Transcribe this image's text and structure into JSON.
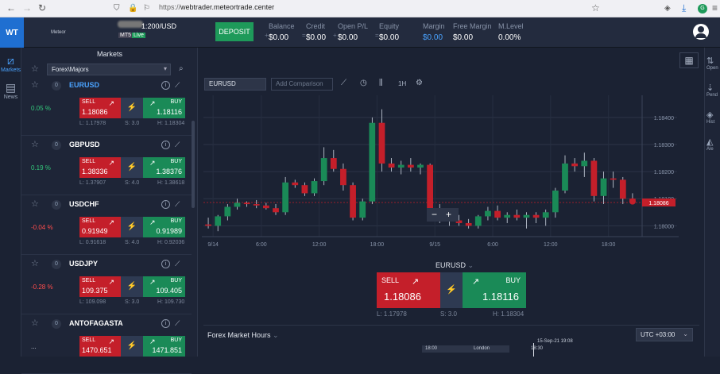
{
  "browser": {
    "url_prefix": "https://",
    "url_host": "webtrader.meteortrade.center"
  },
  "header": {
    "logo": "WT",
    "brand_text": "Meteor",
    "account": "1:200/USD",
    "platform_badge": "MT5",
    "live_badge": "Live",
    "deposit_label": "DEPOSIT",
    "stats": [
      {
        "label": "Balance",
        "value": "$0.00",
        "color": "#ffffff"
      },
      {
        "label": "Credit",
        "value": "$0.00",
        "color": "#ffffff"
      },
      {
        "label": "Open P/L",
        "value": "$0.00",
        "color": "#ffffff"
      },
      {
        "label": "Equity",
        "value": "$0.00",
        "color": "#ffffff"
      },
      {
        "label": "Margin",
        "value": "$0.00",
        "color": "#4aa3ff"
      },
      {
        "label": "Free Margin",
        "value": "$0.00",
        "color": "#ffffff"
      },
      {
        "label": "M.Level",
        "value": "0.00%",
        "color": "#ffffff"
      }
    ]
  },
  "left_rail": {
    "items": [
      {
        "label": "Markets",
        "icon": "chart-icon",
        "active": true
      },
      {
        "label": "News",
        "icon": "news-icon",
        "active": false
      }
    ]
  },
  "markets": {
    "title": "Markets",
    "category": "Forex\\Majors",
    "sell_label": "SELL",
    "buy_label": "BUY",
    "rows": [
      {
        "badge": "0",
        "symbol": "EURUSD",
        "change": "0.05 %",
        "dir": "pos",
        "sell": "1.18086",
        "buy": "1.18116",
        "low": "L: 1.17978",
        "spread": "S: 3.0",
        "high": "H: 1.18304",
        "active": true
      },
      {
        "badge": "0",
        "symbol": "GBPUSD",
        "change": "0.19 %",
        "dir": "pos",
        "sell": "1.38336",
        "buy": "1.38376",
        "low": "L: 1.37907",
        "spread": "S: 4.0",
        "high": "H: 1.38618",
        "active": false
      },
      {
        "badge": "0",
        "symbol": "USDCHF",
        "change": "-0.04 %",
        "dir": "neg",
        "sell": "0.91949",
        "buy": "0.91989",
        "low": "L: 0.91618",
        "spread": "S: 4.0",
        "high": "H: 0.92036",
        "active": false
      },
      {
        "badge": "0",
        "symbol": "USDJPY",
        "change": "-0.28 %",
        "dir": "neg",
        "sell": "109.375",
        "buy": "109.405",
        "low": "L: 109.098",
        "spread": "S: 3.0",
        "high": "H: 109.730",
        "active": false
      },
      {
        "badge": "0",
        "symbol": "ANTOFAGASTA",
        "change": "...",
        "dir": "none",
        "sell": "1470.651",
        "buy": "1471.851",
        "low": "",
        "spread": "",
        "high": "",
        "active": false
      }
    ]
  },
  "chart_toolbar": {
    "symbol": "EURUSD",
    "compare_placeholder": "Add Comparison",
    "timeframe": "1H"
  },
  "chart_data": {
    "type": "candlestick",
    "symbol": "EURUSD",
    "x_ticks": [
      "9/14",
      "6:00",
      "12:00",
      "18:00",
      "9/15",
      "6:00",
      "12:00",
      "18:00"
    ],
    "y_ticks": [
      "1.18400",
      "1.18300",
      "1.18200",
      "1.18100",
      "1.18000"
    ],
    "ylim": [
      1.1796,
      1.1847
    ],
    "last_price": "1.18086",
    "candles": [
      {
        "o": 1.18005,
        "h": 1.1803,
        "l": 1.1799,
        "c": 1.18
      },
      {
        "o": 1.18,
        "h": 1.1804,
        "l": 1.1798,
        "c": 1.18035
      },
      {
        "o": 1.18035,
        "h": 1.1808,
        "l": 1.1802,
        "c": 1.1807
      },
      {
        "o": 1.1807,
        "h": 1.181,
        "l": 1.1806,
        "c": 1.18085
      },
      {
        "o": 1.18085,
        "h": 1.1809,
        "l": 1.1807,
        "c": 1.1808
      },
      {
        "o": 1.1808,
        "h": 1.18095,
        "l": 1.18065,
        "c": 1.18075
      },
      {
        "o": 1.18075,
        "h": 1.18085,
        "l": 1.1806,
        "c": 1.18065
      },
      {
        "o": 1.18065,
        "h": 1.1808,
        "l": 1.1804,
        "c": 1.1805
      },
      {
        "o": 1.1805,
        "h": 1.1818,
        "l": 1.1804,
        "c": 1.1816
      },
      {
        "o": 1.1816,
        "h": 1.1817,
        "l": 1.1814,
        "c": 1.1815
      },
      {
        "o": 1.1815,
        "h": 1.1816,
        "l": 1.1811,
        "c": 1.1812
      },
      {
        "o": 1.1812,
        "h": 1.18175,
        "l": 1.1811,
        "c": 1.18165
      },
      {
        "o": 1.18165,
        "h": 1.1829,
        "l": 1.1815,
        "c": 1.1825
      },
      {
        "o": 1.1825,
        "h": 1.1828,
        "l": 1.182,
        "c": 1.1821
      },
      {
        "o": 1.1821,
        "h": 1.1823,
        "l": 1.1813,
        "c": 1.1815
      },
      {
        "o": 1.1815,
        "h": 1.1816,
        "l": 1.1802,
        "c": 1.1803
      },
      {
        "o": 1.1803,
        "h": 1.181,
        "l": 1.1802,
        "c": 1.1809
      },
      {
        "o": 1.1809,
        "h": 1.184,
        "l": 1.1808,
        "c": 1.1838
      },
      {
        "o": 1.1838,
        "h": 1.1843,
        "l": 1.182,
        "c": 1.1823
      },
      {
        "o": 1.1823,
        "h": 1.1825,
        "l": 1.182,
        "c": 1.18215
      },
      {
        "o": 1.18215,
        "h": 1.1824,
        "l": 1.1819,
        "c": 1.18225
      },
      {
        "o": 1.18225,
        "h": 1.1825,
        "l": 1.182,
        "c": 1.18215
      },
      {
        "o": 1.18215,
        "h": 1.1823,
        "l": 1.1819,
        "c": 1.18225
      },
      {
        "o": 1.18225,
        "h": 1.1823,
        "l": 1.1805,
        "c": 1.1806
      },
      {
        "o": 1.1806,
        "h": 1.1808,
        "l": 1.1801,
        "c": 1.1803
      },
      {
        "o": 1.1803,
        "h": 1.1805,
        "l": 1.18,
        "c": 1.1802
      },
      {
        "o": 1.1802,
        "h": 1.1804,
        "l": 1.18,
        "c": 1.1801
      },
      {
        "o": 1.1801,
        "h": 1.18025,
        "l": 1.1799,
        "c": 1.18
      },
      {
        "o": 1.18,
        "h": 1.1804,
        "l": 1.1799,
        "c": 1.18035
      },
      {
        "o": 1.18035,
        "h": 1.1807,
        "l": 1.1802,
        "c": 1.18055
      },
      {
        "o": 1.18055,
        "h": 1.18075,
        "l": 1.1802,
        "c": 1.1803
      },
      {
        "o": 1.1803,
        "h": 1.1805,
        "l": 1.1801,
        "c": 1.1804
      },
      {
        "o": 1.1804,
        "h": 1.1806,
        "l": 1.1802,
        "c": 1.1803
      },
      {
        "o": 1.1803,
        "h": 1.1805,
        "l": 1.1799,
        "c": 1.1804
      },
      {
        "o": 1.1804,
        "h": 1.1805,
        "l": 1.1801,
        "c": 1.1803
      },
      {
        "o": 1.1803,
        "h": 1.1806,
        "l": 1.18,
        "c": 1.1805
      },
      {
        "o": 1.1805,
        "h": 1.1814,
        "l": 1.1803,
        "c": 1.1813
      },
      {
        "o": 1.1813,
        "h": 1.1826,
        "l": 1.1812,
        "c": 1.1823
      },
      {
        "o": 1.1823,
        "h": 1.1825,
        "l": 1.182,
        "c": 1.1822
      },
      {
        "o": 1.1822,
        "h": 1.1827,
        "l": 1.1818,
        "c": 1.1824
      },
      {
        "o": 1.1824,
        "h": 1.1825,
        "l": 1.1809,
        "c": 1.1811
      },
      {
        "o": 1.1811,
        "h": 1.182,
        "l": 1.1808,
        "c": 1.18175
      },
      {
        "o": 1.18175,
        "h": 1.182,
        "l": 1.1814,
        "c": 1.1817
      },
      {
        "o": 1.1817,
        "h": 1.1818,
        "l": 1.1808,
        "c": 1.181
      },
      {
        "o": 1.181,
        "h": 1.1812,
        "l": 1.18085,
        "c": 1.1809
      }
    ]
  },
  "trade": {
    "symbol": "EURUSD",
    "sell_label": "SELL",
    "buy_label": "BUY",
    "sell": "1.18086",
    "buy": "1.18116",
    "low": "L: 1.17978",
    "spread": "S: 3.0",
    "high": "H: 1.18304"
  },
  "forex_hours": {
    "title": "Forex Market Hours",
    "timezone": "UTC +03:00",
    "date_marker": "15-Sep-21 19:08",
    "labels": [
      "18:00",
      "London",
      "18:30"
    ]
  },
  "right_rail": {
    "items": [
      "Open",
      "Pend",
      "Hist",
      "Ale"
    ]
  }
}
